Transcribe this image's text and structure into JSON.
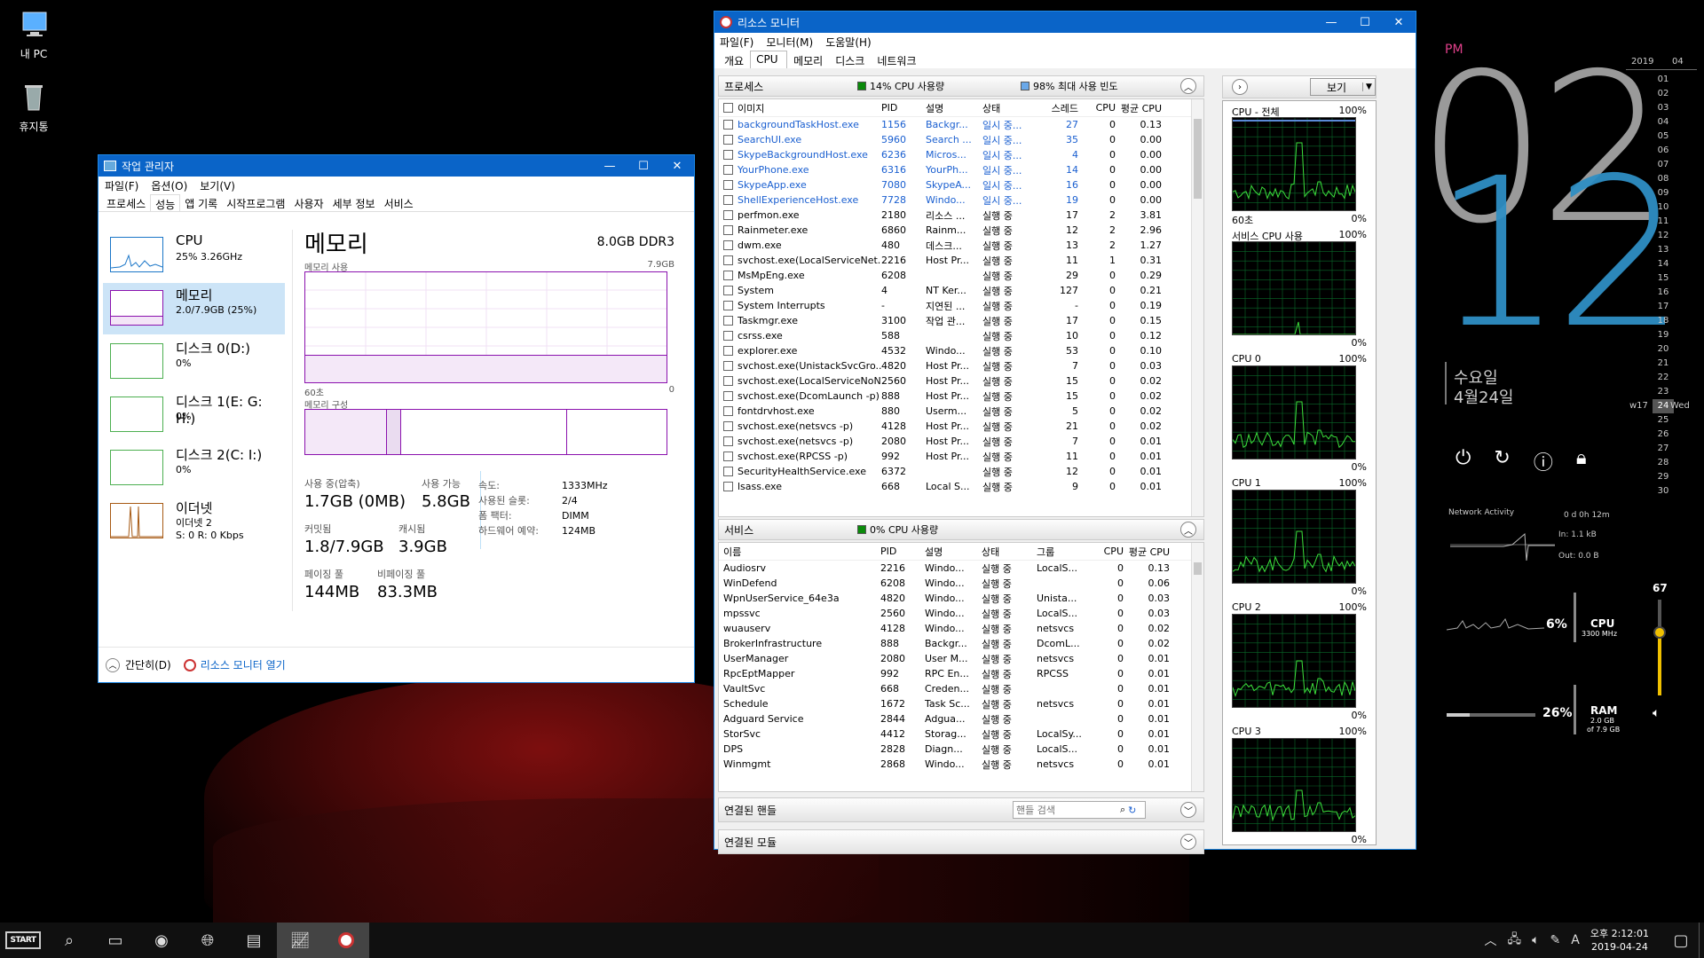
{
  "desktop": {
    "icons": [
      {
        "label": "내 PC",
        "icon": "monitor-icon"
      },
      {
        "label": "휴지통",
        "icon": "recycle-bin-icon"
      }
    ]
  },
  "task_manager": {
    "title": "작업 관리자",
    "menu": [
      "파일(F)",
      "옵션(O)",
      "보기(V)"
    ],
    "tabs": [
      "프로세스",
      "성능",
      "앱 기록",
      "시작프로그램",
      "사용자",
      "세부 정보",
      "서비스"
    ],
    "active_tab": "성능",
    "sidebar": [
      {
        "name": "CPU",
        "sub": "25% 3.26GHz",
        "color": "#1a76c8"
      },
      {
        "name": "메모리",
        "sub": "2.0/7.9GB (25%)",
        "color": "#8b12ae"
      },
      {
        "name": "디스크 0(D:)",
        "sub": "0%",
        "color": "#4caf50"
      },
      {
        "name": "디스크 1(E: G: H:)",
        "sub": "0%",
        "color": "#4caf50"
      },
      {
        "name": "디스크 2(C: I:)",
        "sub": "0%",
        "color": "#4caf50"
      },
      {
        "name": "이더넷",
        "sub": "이더넷 2",
        "sub2": "S: 0 R: 0 Kbps",
        "color": "#a75a14"
      }
    ],
    "memory": {
      "heading": "메모리",
      "spec": "8.0GB DDR3",
      "usage_label": "메모리 사용",
      "usage_max": "7.9GB",
      "axis_left": "60초",
      "axis_right": "0",
      "composition_label": "메모리 구성",
      "stats": [
        {
          "label": "사용 중(압축)",
          "value": "1.7GB (0MB)"
        },
        {
          "label": "사용 가능",
          "value": "5.8GB"
        },
        {
          "label": "커밋됨",
          "value": "1.8/7.9GB"
        },
        {
          "label": "캐시됨",
          "value": "3.9GB"
        },
        {
          "label": "페이징 풀",
          "value": "144MB"
        },
        {
          "label": "비페이징 풀",
          "value": "83.3MB"
        }
      ],
      "details": [
        {
          "label": "속도:",
          "value": "1333MHz"
        },
        {
          "label": "사용된 슬롯:",
          "value": "2/4"
        },
        {
          "label": "폼 팩터:",
          "value": "DIMM"
        },
        {
          "label": "하드웨어 예약:",
          "value": "124MB"
        }
      ]
    },
    "footer": {
      "collapse": "간단히(D)",
      "open_resmon": "리소스 모니터 열기"
    }
  },
  "resource_monitor": {
    "title": "리소스 모니터",
    "menu": [
      "파일(F)",
      "모니터(M)",
      "도움말(H)"
    ],
    "tabs": [
      "개요",
      "CPU",
      "메모리",
      "디스크",
      "네트워크"
    ],
    "active_tab": "CPU",
    "processes": {
      "header": "프로세스",
      "ind1": "14% CPU 사용량",
      "ind2": "98% 최대 사용 빈도",
      "columns": [
        "이미지",
        "PID",
        "설명",
        "상태",
        "스레드",
        "CPU",
        "평균 CPU"
      ],
      "rows": [
        [
          "backgroundTaskHost.exe",
          "1156",
          "Backgr...",
          "일시 중...",
          "27",
          "0",
          "0.13"
        ],
        [
          "SearchUI.exe",
          "5960",
          "Search ...",
          "일시 중...",
          "35",
          "0",
          "0.00"
        ],
        [
          "SkypeBackgroundHost.exe",
          "6236",
          "Micros...",
          "일시 중...",
          "4",
          "0",
          "0.00"
        ],
        [
          "YourPhone.exe",
          "6316",
          "YourPh...",
          "일시 중...",
          "14",
          "0",
          "0.00"
        ],
        [
          "SkypeApp.exe",
          "7080",
          "SkypeA...",
          "일시 중...",
          "16",
          "0",
          "0.00"
        ],
        [
          "ShellExperienceHost.exe",
          "7728",
          "Windo...",
          "일시 중...",
          "19",
          "0",
          "0.00"
        ],
        [
          "perfmon.exe",
          "2180",
          "리소스 ...",
          "실행 중",
          "17",
          "2",
          "3.81"
        ],
        [
          "Rainmeter.exe",
          "6860",
          "Rainm...",
          "실행 중",
          "12",
          "2",
          "2.96"
        ],
        [
          "dwm.exe",
          "480",
          "데스크...",
          "실행 중",
          "13",
          "2",
          "1.27"
        ],
        [
          "svchost.exe(LocalServiceNet...",
          "2216",
          "Host Pr...",
          "실행 중",
          "11",
          "1",
          "0.31"
        ],
        [
          "MsMpEng.exe",
          "6208",
          "",
          "실행 중",
          "29",
          "0",
          "0.29"
        ],
        [
          "System",
          "4",
          "NT Ker...",
          "실행 중",
          "127",
          "0",
          "0.21"
        ],
        [
          "System Interrupts",
          "-",
          "지연된 ...",
          "실행 중",
          "-",
          "0",
          "0.19"
        ],
        [
          "Taskmgr.exe",
          "3100",
          "작업 관...",
          "실행 중",
          "17",
          "0",
          "0.15"
        ],
        [
          "csrss.exe",
          "588",
          "",
          "실행 중",
          "10",
          "0",
          "0.12"
        ],
        [
          "explorer.exe",
          "4532",
          "Windo...",
          "실행 중",
          "53",
          "0",
          "0.10"
        ],
        [
          "svchost.exe(UnistackSvcGro...",
          "4820",
          "Host Pr...",
          "실행 중",
          "7",
          "0",
          "0.03"
        ],
        [
          "svchost.exe(LocalServiceNoN...",
          "2560",
          "Host Pr...",
          "실행 중",
          "15",
          "0",
          "0.02"
        ],
        [
          "svchost.exe(DcomLaunch -p)",
          "888",
          "Host Pr...",
          "실행 중",
          "15",
          "0",
          "0.02"
        ],
        [
          "fontdrvhost.exe",
          "880",
          "Userm...",
          "실행 중",
          "5",
          "0",
          "0.02"
        ],
        [
          "svchost.exe(netsvcs -p)",
          "4128",
          "Host Pr...",
          "실행 중",
          "21",
          "0",
          "0.02"
        ],
        [
          "svchost.exe(netsvcs -p)",
          "2080",
          "Host Pr...",
          "실행 중",
          "7",
          "0",
          "0.01"
        ],
        [
          "svchost.exe(RPCSS -p)",
          "992",
          "Host Pr...",
          "실행 중",
          "11",
          "0",
          "0.01"
        ],
        [
          "SecurityHealthService.exe",
          "6372",
          "",
          "실행 중",
          "12",
          "0",
          "0.01"
        ],
        [
          "lsass.exe",
          "668",
          "Local S...",
          "실행 중",
          "9",
          "0",
          "0.01"
        ]
      ]
    },
    "services": {
      "header": "서비스",
      "ind1": "0% CPU 사용량",
      "columns": [
        "이름",
        "PID",
        "설명",
        "상태",
        "그룹",
        "CPU",
        "평균 CPU"
      ],
      "rows": [
        [
          "Audiosrv",
          "2216",
          "Windo...",
          "실행 중",
          "LocalS...",
          "0",
          "0.13"
        ],
        [
          "WinDefend",
          "6208",
          "Windo...",
          "실행 중",
          "",
          "0",
          "0.06"
        ],
        [
          "WpnUserService_64e3a",
          "4820",
          "Windo...",
          "실행 중",
          "Unista...",
          "0",
          "0.03"
        ],
        [
          "mpssvc",
          "2560",
          "Windo...",
          "실행 중",
          "LocalS...",
          "0",
          "0.03"
        ],
        [
          "wuauserv",
          "4128",
          "Windo...",
          "실행 중",
          "netsvcs",
          "0",
          "0.02"
        ],
        [
          "BrokerInfrastructure",
          "888",
          "Backgr...",
          "실행 중",
          "DcomL...",
          "0",
          "0.02"
        ],
        [
          "UserManager",
          "2080",
          "User M...",
          "실행 중",
          "netsvcs",
          "0",
          "0.01"
        ],
        [
          "RpcEptMapper",
          "992",
          "RPC En...",
          "실행 중",
          "RPCSS",
          "0",
          "0.01"
        ],
        [
          "VaultSvc",
          "668",
          "Creden...",
          "실행 중",
          "",
          "0",
          "0.01"
        ],
        [
          "Schedule",
          "1672",
          "Task Sc...",
          "실행 중",
          "netsvcs",
          "0",
          "0.01"
        ],
        [
          "Adguard Service",
          "2844",
          "Adgua...",
          "실행 중",
          "",
          "0",
          "0.01"
        ],
        [
          "StorSvc",
          "4412",
          "Storag...",
          "실행 중",
          "LocalSy...",
          "0",
          "0.01"
        ],
        [
          "DPS",
          "2828",
          "Diagn...",
          "실행 중",
          "LocalS...",
          "0",
          "0.01"
        ],
        [
          "Winmgmt",
          "2868",
          "Windo...",
          "실행 중",
          "netsvcs",
          "0",
          "0.01"
        ]
      ]
    },
    "handles": {
      "header": "연결된 핸들",
      "search_placeholder": "핸들 검색"
    },
    "modules": {
      "header": "연결된 모듈"
    },
    "graphs": {
      "view_button": "보기",
      "items": [
        {
          "label": "CPU - 전체",
          "top": "100%",
          "bottom": "0%",
          "axis": "60초"
        },
        {
          "label": "서비스 CPU 사용",
          "top": "100%",
          "bottom": "0%"
        },
        {
          "label": "CPU 0",
          "top": "100%",
          "bottom": "0%"
        },
        {
          "label": "CPU 1",
          "top": "100%",
          "bottom": "0%"
        },
        {
          "label": "CPU 2",
          "top": "100%",
          "bottom": "0%"
        },
        {
          "label": "CPU 3",
          "top": "100%",
          "bottom": "0%"
        }
      ]
    }
  },
  "rainmeter": {
    "ampm": "PM",
    "hour": "02",
    "minute": "12",
    "weekday": "수요일",
    "date": "4월24일",
    "network": {
      "title": "Network Activity",
      "uptime": "0 d 0h 12m",
      "in": "In: 1.1 kB",
      "out": "Out: 0.0 B"
    },
    "cpu": {
      "pct": "6%",
      "label": "CPU",
      "sub": "3300 MHz"
    },
    "ram": {
      "pct": "26%",
      "label": "RAM",
      "sub1": "2.0 GB",
      "sub2": "of 7.9 GB"
    },
    "volume": "67",
    "calendar": {
      "year": "2019",
      "month": "04",
      "days": [
        "01",
        "02",
        "03",
        "04",
        "05",
        "06",
        "07",
        "08",
        "09",
        "10",
        "11",
        "12",
        "13",
        "14",
        "15",
        "16",
        "17",
        "18",
        "19",
        "20",
        "21",
        "22",
        "23",
        "24",
        "25",
        "26",
        "27",
        "28",
        "29",
        "30"
      ],
      "today": "24",
      "week": "w17",
      "today_name": "Wed"
    }
  },
  "taskbar": {
    "start": "START",
    "clock_time": "오후 2:12:01",
    "clock_date": "2019-04-24",
    "ime": "A"
  }
}
